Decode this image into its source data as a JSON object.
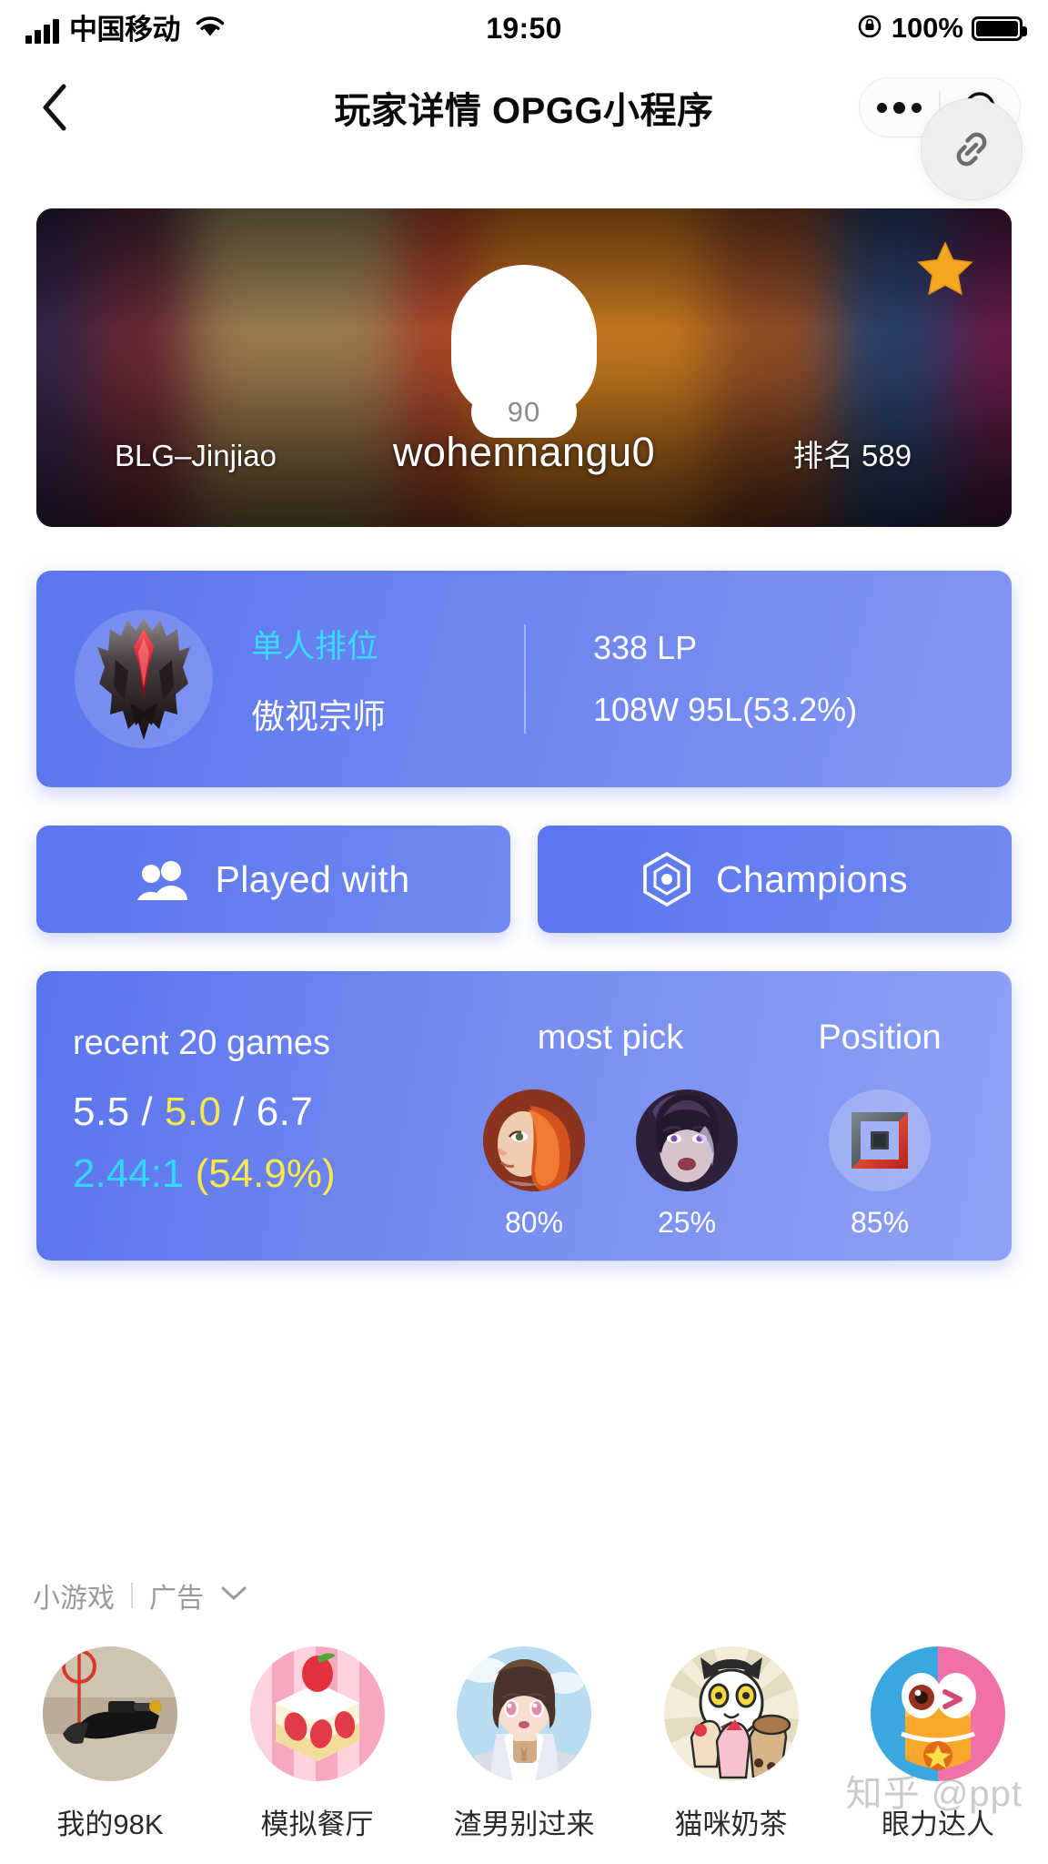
{
  "status_bar": {
    "carrier": "中国移动",
    "time": "19:50",
    "battery_percent": "100%",
    "signal_icon": "signal-bars-icon",
    "wifi_icon": "wifi-icon",
    "lock_icon": "rotation-lock-icon",
    "battery_icon": "battery-full-icon"
  },
  "nav": {
    "back_icon": "back-chevron-icon",
    "title": "玩家详情 OPGG小程序",
    "more_icon": "more-dots-icon",
    "target_icon": "capsule-close-icon",
    "link_icon": "link-icon"
  },
  "banner": {
    "level": "90",
    "team_tag": "BLG–Jinjiao",
    "summoner_name": "wohennangu0",
    "rank_label": "排名 589",
    "star_icon": "favorite-star-icon",
    "avatar_icon": "default-avatar-icon"
  },
  "tier_card": {
    "emblem_icon": "grandmaster-emblem-icon",
    "queue": "单人排位",
    "tier": "傲视宗师",
    "lp": "338 LP",
    "winloss": "108W 95L(53.2%)",
    "queue_color": "#38dcff"
  },
  "actions": [
    {
      "label": "Played with",
      "icon": "people-icon"
    },
    {
      "label": "Champions",
      "icon": "hexagon-champion-icon"
    }
  ],
  "stats": {
    "headers": {
      "recent": "recent 20 games",
      "most_pick": "most pick",
      "position": "Position"
    },
    "kda": "5.5 / 5.0 / 6.7",
    "kda_kills": "5.5",
    "kda_deaths": "5.0",
    "kda_assists": "6.7",
    "kda_sep": " / ",
    "ratio": "2.44:1",
    "winrate": "(54.9%)",
    "champions": [
      {
        "name": "champion-portrait-red",
        "percent": "80%"
      },
      {
        "name": "champion-portrait-purple",
        "percent": "25%"
      }
    ],
    "position": {
      "icon": "lane-position-icon",
      "percent": "85%"
    },
    "colors": {
      "deaths": "#f7e94b",
      "ratio": "#32d8f7",
      "winrate": "#f7e94b"
    }
  },
  "ads": {
    "section_label": "小游戏",
    "ad_label": "广告",
    "chevron_icon": "chevron-down-icon",
    "items": [
      {
        "label": "我的98K",
        "icon": "sniper-game-icon"
      },
      {
        "label": "模拟餐厅",
        "icon": "cake-game-icon"
      },
      {
        "label": "渣男别过来",
        "icon": "anime-girl-game-icon"
      },
      {
        "label": "猫咪奶茶",
        "icon": "cat-milktea-game-icon"
      },
      {
        "label": "眼力达人",
        "icon": "eye-test-game-icon"
      }
    ]
  },
  "watermark": "知乎 @ppt"
}
